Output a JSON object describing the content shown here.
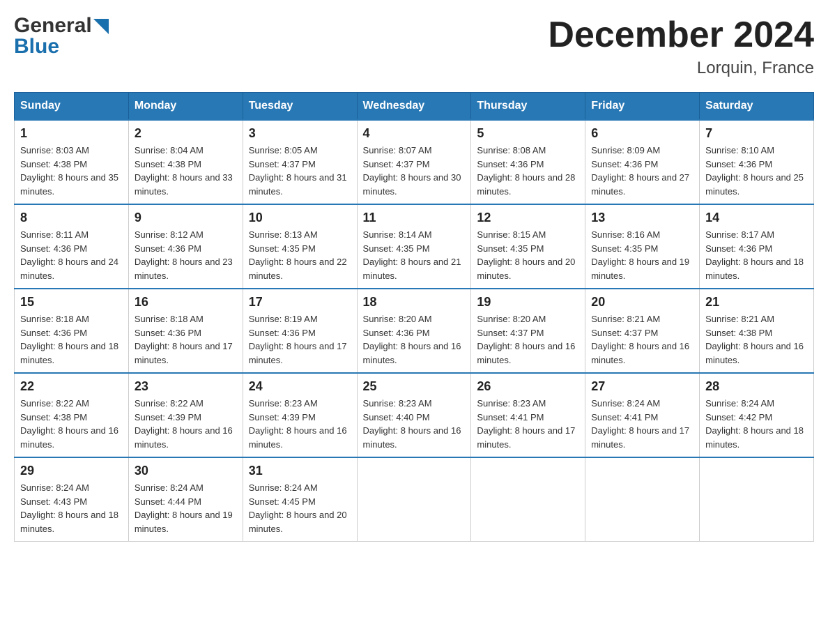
{
  "header": {
    "logo_top": "General",
    "logo_bottom": "Blue",
    "title": "December 2024",
    "subtitle": "Lorquin, France"
  },
  "calendar": {
    "headers": [
      "Sunday",
      "Monday",
      "Tuesday",
      "Wednesday",
      "Thursday",
      "Friday",
      "Saturday"
    ],
    "weeks": [
      [
        {
          "day": "1",
          "sunrise": "8:03 AM",
          "sunset": "4:38 PM",
          "daylight": "8 hours and 35 minutes."
        },
        {
          "day": "2",
          "sunrise": "8:04 AM",
          "sunset": "4:38 PM",
          "daylight": "8 hours and 33 minutes."
        },
        {
          "day": "3",
          "sunrise": "8:05 AM",
          "sunset": "4:37 PM",
          "daylight": "8 hours and 31 minutes."
        },
        {
          "day": "4",
          "sunrise": "8:07 AM",
          "sunset": "4:37 PM",
          "daylight": "8 hours and 30 minutes."
        },
        {
          "day": "5",
          "sunrise": "8:08 AM",
          "sunset": "4:36 PM",
          "daylight": "8 hours and 28 minutes."
        },
        {
          "day": "6",
          "sunrise": "8:09 AM",
          "sunset": "4:36 PM",
          "daylight": "8 hours and 27 minutes."
        },
        {
          "day": "7",
          "sunrise": "8:10 AM",
          "sunset": "4:36 PM",
          "daylight": "8 hours and 25 minutes."
        }
      ],
      [
        {
          "day": "8",
          "sunrise": "8:11 AM",
          "sunset": "4:36 PM",
          "daylight": "8 hours and 24 minutes."
        },
        {
          "day": "9",
          "sunrise": "8:12 AM",
          "sunset": "4:36 PM",
          "daylight": "8 hours and 23 minutes."
        },
        {
          "day": "10",
          "sunrise": "8:13 AM",
          "sunset": "4:35 PM",
          "daylight": "8 hours and 22 minutes."
        },
        {
          "day": "11",
          "sunrise": "8:14 AM",
          "sunset": "4:35 PM",
          "daylight": "8 hours and 21 minutes."
        },
        {
          "day": "12",
          "sunrise": "8:15 AM",
          "sunset": "4:35 PM",
          "daylight": "8 hours and 20 minutes."
        },
        {
          "day": "13",
          "sunrise": "8:16 AM",
          "sunset": "4:35 PM",
          "daylight": "8 hours and 19 minutes."
        },
        {
          "day": "14",
          "sunrise": "8:17 AM",
          "sunset": "4:36 PM",
          "daylight": "8 hours and 18 minutes."
        }
      ],
      [
        {
          "day": "15",
          "sunrise": "8:18 AM",
          "sunset": "4:36 PM",
          "daylight": "8 hours and 18 minutes."
        },
        {
          "day": "16",
          "sunrise": "8:18 AM",
          "sunset": "4:36 PM",
          "daylight": "8 hours and 17 minutes."
        },
        {
          "day": "17",
          "sunrise": "8:19 AM",
          "sunset": "4:36 PM",
          "daylight": "8 hours and 17 minutes."
        },
        {
          "day": "18",
          "sunrise": "8:20 AM",
          "sunset": "4:36 PM",
          "daylight": "8 hours and 16 minutes."
        },
        {
          "day": "19",
          "sunrise": "8:20 AM",
          "sunset": "4:37 PM",
          "daylight": "8 hours and 16 minutes."
        },
        {
          "day": "20",
          "sunrise": "8:21 AM",
          "sunset": "4:37 PM",
          "daylight": "8 hours and 16 minutes."
        },
        {
          "day": "21",
          "sunrise": "8:21 AM",
          "sunset": "4:38 PM",
          "daylight": "8 hours and 16 minutes."
        }
      ],
      [
        {
          "day": "22",
          "sunrise": "8:22 AM",
          "sunset": "4:38 PM",
          "daylight": "8 hours and 16 minutes."
        },
        {
          "day": "23",
          "sunrise": "8:22 AM",
          "sunset": "4:39 PM",
          "daylight": "8 hours and 16 minutes."
        },
        {
          "day": "24",
          "sunrise": "8:23 AM",
          "sunset": "4:39 PM",
          "daylight": "8 hours and 16 minutes."
        },
        {
          "day": "25",
          "sunrise": "8:23 AM",
          "sunset": "4:40 PM",
          "daylight": "8 hours and 16 minutes."
        },
        {
          "day": "26",
          "sunrise": "8:23 AM",
          "sunset": "4:41 PM",
          "daylight": "8 hours and 17 minutes."
        },
        {
          "day": "27",
          "sunrise": "8:24 AM",
          "sunset": "4:41 PM",
          "daylight": "8 hours and 17 minutes."
        },
        {
          "day": "28",
          "sunrise": "8:24 AM",
          "sunset": "4:42 PM",
          "daylight": "8 hours and 18 minutes."
        }
      ],
      [
        {
          "day": "29",
          "sunrise": "8:24 AM",
          "sunset": "4:43 PM",
          "daylight": "8 hours and 18 minutes."
        },
        {
          "day": "30",
          "sunrise": "8:24 AM",
          "sunset": "4:44 PM",
          "daylight": "8 hours and 19 minutes."
        },
        {
          "day": "31",
          "sunrise": "8:24 AM",
          "sunset": "4:45 PM",
          "daylight": "8 hours and 20 minutes."
        },
        null,
        null,
        null,
        null
      ]
    ],
    "labels": {
      "sunrise_prefix": "Sunrise: ",
      "sunset_prefix": "Sunset: ",
      "daylight_prefix": "Daylight: "
    }
  }
}
